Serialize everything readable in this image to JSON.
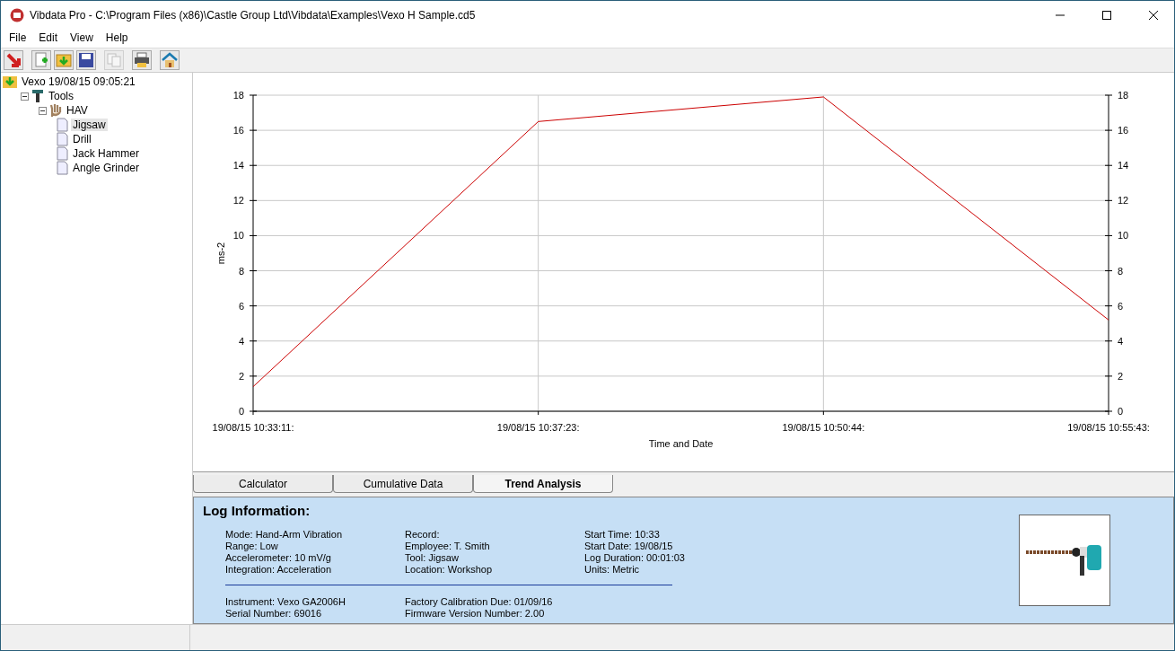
{
  "window": {
    "title": "Vibdata Pro - C:\\Program Files (x86)\\Castle Group Ltd\\Vibdata\\Examples\\Vexo H Sample.cd5"
  },
  "menu": [
    "File",
    "Edit",
    "View",
    "Help"
  ],
  "toolbar": [
    {
      "kind": "exit"
    },
    {
      "kind": "new"
    },
    {
      "kind": "open"
    },
    {
      "kind": "save"
    },
    {
      "kind": "copy",
      "disabled": true
    },
    {
      "kind": "print"
    },
    {
      "kind": "home"
    }
  ],
  "tree": [
    {
      "label": "Vexo 19/08/15 09:05:21",
      "kind": "log",
      "children": [
        {
          "label": "Tools",
          "kind": "tools",
          "expanded": true,
          "children": [
            {
              "label": "HAV",
              "kind": "group",
              "expanded": true,
              "children": [
                {
                  "label": "Jigsaw",
                  "kind": "file",
                  "selected": true
                },
                {
                  "label": "Drill",
                  "kind": "file",
                  "selected": false
                },
                {
                  "label": "Jack Hammer",
                  "kind": "file",
                  "selected": false
                },
                {
                  "label": "Angle Grinder",
                  "kind": "file",
                  "selected": false
                }
              ]
            }
          ]
        }
      ]
    }
  ],
  "chart": {
    "category_suffix": ":",
    "right_axis_labels": [
      "18",
      "16",
      "14",
      "12",
      "10",
      "8",
      "6",
      "4",
      "2",
      "0"
    ],
    "chart_data": {
      "type": "line",
      "grid": true,
      "xlabel": "Time and Date",
      "ylabel": "ms-2",
      "categories": [
        "19/08/15 10:33:11",
        "19/08/15 10:37:23",
        "19/08/15 10:50:44",
        "19/08/15 10:55:43"
      ],
      "series": [
        {
          "color": "#cc0000",
          "values": [
            1.4,
            16.5,
            17.9,
            5.2
          ]
        }
      ],
      "ylim": [
        0,
        18
      ],
      "yticks": [
        0,
        2,
        4,
        6,
        8,
        10,
        12,
        14,
        16,
        18
      ]
    }
  },
  "tabs": [
    {
      "label": "Calculator",
      "selected": false
    },
    {
      "label": "Cumulative Data",
      "selected": false
    },
    {
      "label": "Trend Analysis",
      "selected": true
    }
  ],
  "log": {
    "title": "Log Information:",
    "columns": [
      [
        "Mode: Hand-Arm Vibration",
        "Range: Low",
        "Accelerometer: 10  mV/g",
        "Integration: Acceleration"
      ],
      [
        "Record:",
        "Employee: T. Smith",
        "Tool: Jigsaw",
        "Location: Workshop"
      ],
      [
        "Start Time: 10:33",
        "Start Date: 19/08/15",
        "Log Duration: 00:01:03",
        "Units: Metric"
      ]
    ],
    "footer": [
      [
        "Instrument: Vexo GA2006H",
        "Serial Number: 69016"
      ],
      [
        "Factory Calibration Due: 01/09/16",
        "Firmware Version Number:  2.00"
      ]
    ]
  }
}
